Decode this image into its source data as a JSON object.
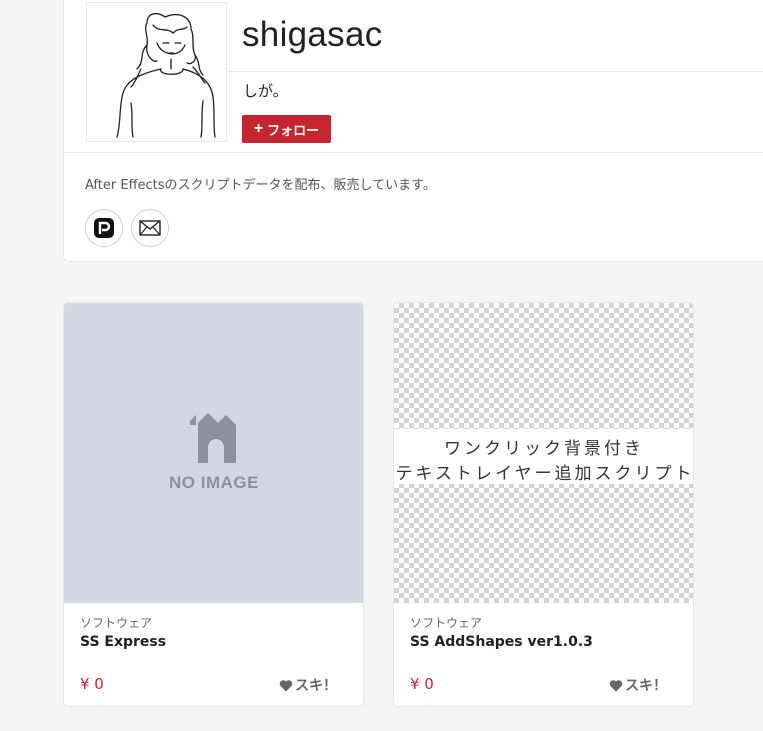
{
  "shop": {
    "name": "shigasac",
    "owner": "しが。",
    "follow_label": "フォロー",
    "description": "After Effectsのスクリプトデータを配布、販売しています。",
    "links": [
      {
        "icon": "pixiv-icon"
      },
      {
        "icon": "mail-icon"
      }
    ]
  },
  "items": [
    {
      "thumbnail_text": "NO IMAGE",
      "category": "ソフトウェア",
      "name": "SS Express",
      "price": "¥ 0",
      "like_label": "スキ！"
    },
    {
      "banner_line1": "ワンクリック背景付き",
      "banner_line2": "テキストレイヤー追加スクリプト",
      "category": "ソフトウェア",
      "name": "SS AddShapes ver1.0.3",
      "price": "¥ 0",
      "like_label": "スキ！"
    }
  ],
  "colors": {
    "accent": "#c4252f",
    "background": "#f5f5f5"
  }
}
